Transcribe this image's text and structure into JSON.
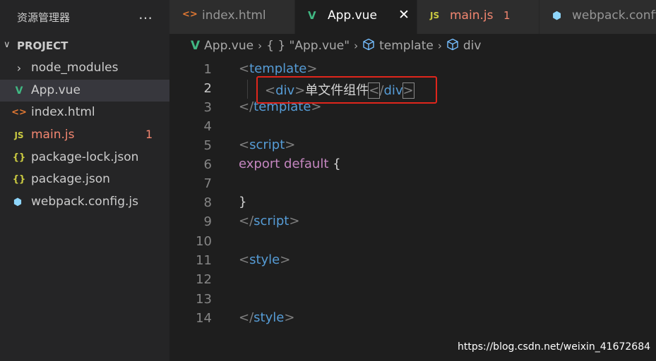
{
  "sidebar": {
    "title": "资源管理器",
    "more_icon": "…",
    "project": {
      "label": "PROJECT",
      "chevron": "∨"
    },
    "items": [
      {
        "icon": "›",
        "icon_name": "folder-chevron-icon",
        "name": "node_modules",
        "badge": ""
      },
      {
        "icon": "V",
        "icon_name": "vue-file-icon",
        "name": "App.vue",
        "badge": ""
      },
      {
        "icon": "<>",
        "icon_name": "html-file-icon",
        "name": "index.html",
        "badge": ""
      },
      {
        "icon": "JS",
        "icon_name": "js-file-icon",
        "name": "main.js",
        "badge": "1"
      },
      {
        "icon": "{}",
        "icon_name": "json-file-icon",
        "name": "package-lock.json",
        "badge": ""
      },
      {
        "icon": "{}",
        "icon_name": "json-file-icon",
        "name": "package.json",
        "badge": ""
      },
      {
        "icon": "⬢",
        "icon_name": "webpack-file-icon",
        "name": "webpack.config.js",
        "badge": ""
      }
    ]
  },
  "tabs": [
    {
      "icon": "<>",
      "label": "index.html",
      "badge": ""
    },
    {
      "icon": "V",
      "label": "App.vue",
      "badge": "",
      "close": "✕"
    },
    {
      "icon": "JS",
      "label": "main.js",
      "badge": "1"
    },
    {
      "icon": "⬢",
      "label": "webpack.config.js",
      "badge": ""
    }
  ],
  "breadcrumb": {
    "file": "App.vue",
    "sep": "›",
    "object": "{ } \"App.vue\"",
    "node1": "template",
    "node2": "div"
  },
  "editor": {
    "line_numbers": [
      "1",
      "2",
      "3",
      "4",
      "5",
      "6",
      "7",
      "8",
      "9",
      "10",
      "11",
      "12",
      "13",
      "14"
    ],
    "lines": {
      "l1_open": "<",
      "l1_tag": "template",
      "l1_close": ">",
      "l2_open": "<",
      "l2_tag": "div",
      "l2_gt": ">",
      "l2_text": "单文件组件",
      "l2_lt": "<",
      "l2_slash": "/",
      "l2_tag2": "div",
      "l2_close": ">",
      "l3_open": "</",
      "l3_tag": "template",
      "l3_close": ">",
      "l5_open": "<",
      "l5_tag": "script",
      "l5_close": ">",
      "l6_kw1": "export",
      "l6_kw2": "default",
      "l6_brace": "{",
      "l8_brace": "}",
      "l9_open": "</",
      "l9_tag": "script",
      "l9_close": ">",
      "l11_open": "<",
      "l11_tag": "style",
      "l11_close": ">",
      "l14_open": "</",
      "l14_tag": "style",
      "l14_close": ">"
    }
  },
  "watermark": "https://blog.csdn.net/weixin_41672684",
  "colors": {
    "accent_vue": "#41b883",
    "js_yellow": "#cbcb41",
    "html_orange": "#e37933",
    "error": "#f48771",
    "highlight_box": "#e0261c"
  }
}
